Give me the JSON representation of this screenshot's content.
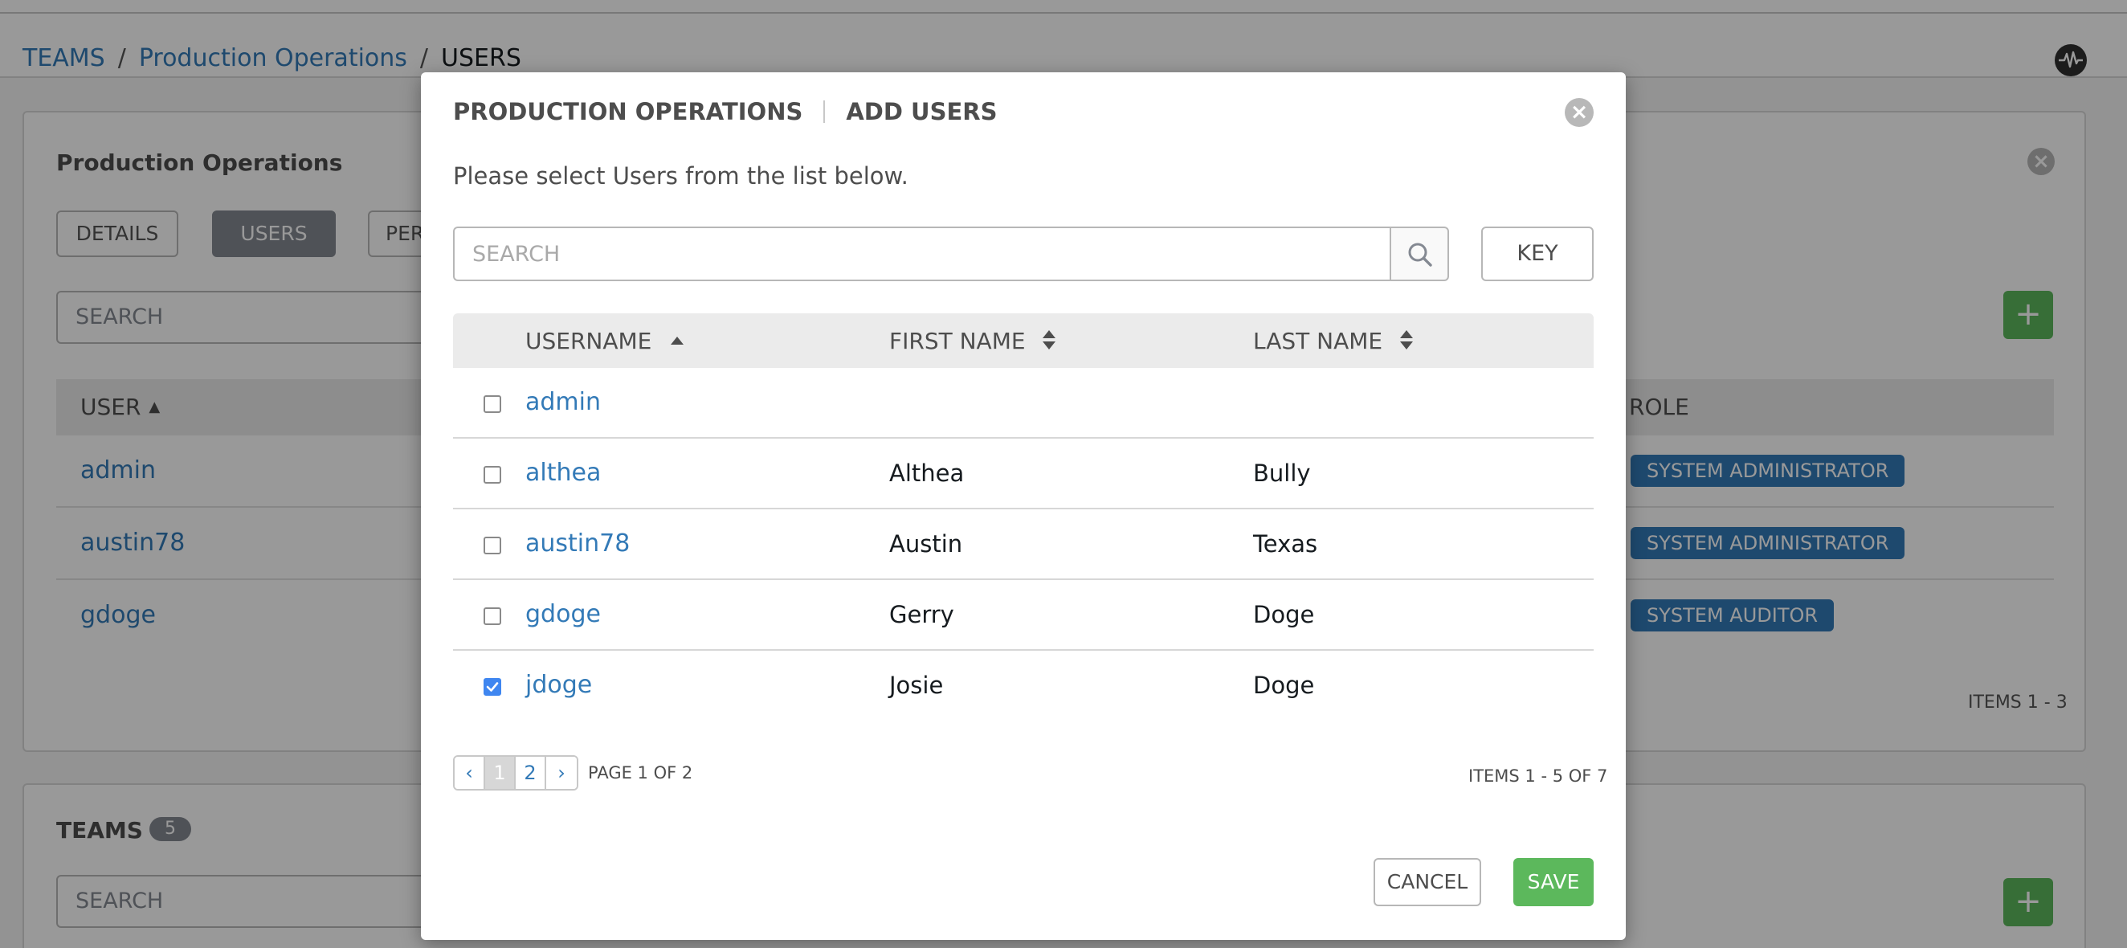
{
  "breadcrumb": {
    "items": [
      {
        "label": "TEAMS"
      },
      {
        "label": "Production Operations"
      },
      {
        "label": "USERS"
      }
    ],
    "separator": "/"
  },
  "background_panel": {
    "title": "Production Operations",
    "close_glyph": "×",
    "tabs": [
      {
        "label": "DETAILS"
      },
      {
        "label": "USERS"
      },
      {
        "label": "PERMISSIONS"
      }
    ],
    "search_placeholder": "SEARCH",
    "add_glyph": "+",
    "list_header": {
      "user": "USER",
      "role": "ROLE"
    },
    "rows": [
      {
        "username": "admin",
        "role": "SYSTEM ADMINISTRATOR"
      },
      {
        "username": "austin78",
        "role": "SYSTEM ADMINISTRATOR"
      },
      {
        "username": "gdoge",
        "role": "SYSTEM AUDITOR"
      }
    ],
    "items_label": "ITEMS  1 - 3"
  },
  "teams_panel": {
    "title": "TEAMS",
    "count": "5",
    "search_placeholder": "SEARCH",
    "add_glyph": "+"
  },
  "modal": {
    "title_primary": "PRODUCTION OPERATIONS",
    "title_secondary": "ADD USERS",
    "close_glyph": "×",
    "instructions": "Please select Users from the list below.",
    "search": {
      "placeholder": "SEARCH"
    },
    "key_label": "KEY",
    "columns": {
      "username": "USERNAME",
      "first_name": "FIRST NAME",
      "last_name": "LAST NAME"
    },
    "rows": [
      {
        "username": "admin",
        "first_name": "",
        "last_name": "",
        "checked": false
      },
      {
        "username": "althea",
        "first_name": "Althea",
        "last_name": "Bully",
        "checked": false
      },
      {
        "username": "austin78",
        "first_name": "Austin",
        "last_name": "Texas",
        "checked": false
      },
      {
        "username": "gdoge",
        "first_name": "Gerry",
        "last_name": "Doge",
        "checked": false
      },
      {
        "username": "jdoge",
        "first_name": "Josie",
        "last_name": "Doge",
        "checked": true
      }
    ],
    "pagination": {
      "prev_glyph": "‹",
      "pages": [
        "1",
        "2"
      ],
      "current_page": "1",
      "next_glyph": "›",
      "page_label": "PAGE 1 OF 2"
    },
    "items_label": "ITEMS  1 - 5 OF 7",
    "cancel_label": "CANCEL",
    "save_label": "SAVE"
  },
  "colors": {
    "link": "#337ab7",
    "save_green": "#5cb85c",
    "badge_blue": "#337ab7",
    "checkbox_checked": "#3f86f0",
    "active_tab": "#848992"
  },
  "icons": [
    "activity-stream-icon",
    "search-icon",
    "close-icon",
    "sort-up-icon",
    "sort-both-icon",
    "checkmark-icon",
    "plus-icon"
  ]
}
